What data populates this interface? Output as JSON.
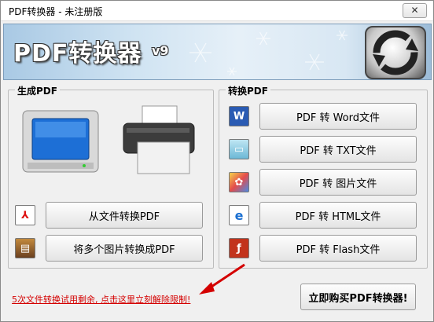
{
  "window": {
    "title": "PDF转换器 - 未注册版",
    "close_symbol": "✕"
  },
  "banner": {
    "title": "PDF转换器",
    "version": "v9"
  },
  "create_group": {
    "label": "生成PDF",
    "buttons": [
      {
        "label": "从文件转换PDF",
        "icon": "pdf-file-icon"
      },
      {
        "label": "将多个图片转换成PDF",
        "icon": "image-file-icon"
      }
    ]
  },
  "convert_group": {
    "label": "转换PDF",
    "buttons": [
      {
        "label": "PDF 转 Word文件",
        "icon": "word-icon"
      },
      {
        "label": "PDF 转 TXT文件",
        "icon": "txt-icon"
      },
      {
        "label": "PDF 转 图片文件",
        "icon": "image-icon"
      },
      {
        "label": "PDF 转 HTML文件",
        "icon": "html-icon"
      },
      {
        "label": "PDF 转 Flash文件",
        "icon": "flash-icon"
      }
    ]
  },
  "footer": {
    "trial_text": "5次文件转换试用剩余, 点击这里立刻解除限制!",
    "buy_label": "立即购买PDF转换器!"
  },
  "colors": {
    "trial_text": "#d40000",
    "banner_blue": "#cfe3f2",
    "word_blue": "#2a5bb3",
    "flash_red": "#c2331c"
  }
}
